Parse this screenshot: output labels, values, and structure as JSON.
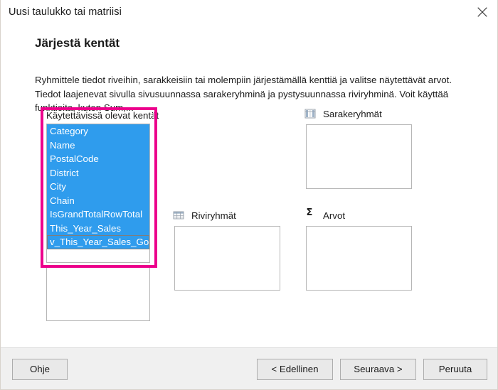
{
  "window": {
    "title": "Uusi taulukko tai matriisi",
    "close_icon": "close-icon"
  },
  "heading": "Järjestä kentät",
  "description": "Ryhmittele tiedot riveihin, sarakkeisiin tai molempiin järjestämällä kenttiä ja valitse näytettävät arvot. Tiedot laajenevat sivulla sivusuunnassa sarakeryhminä ja pystysuunnassa riviryhminä.  Voit käyttää funktioita, kuten Sum,...",
  "available_fields": {
    "label": "Käytettävissä olevat kentät",
    "items": [
      "Category",
      "Name",
      "PostalCode",
      "District",
      "City",
      "Chain",
      "IsGrandTotalRowTotal",
      "This_Year_Sales",
      "v_This_Year_Sales_Goal"
    ],
    "selection_color": "#2f9ced",
    "selection_text_color": "#ffffff",
    "focused_index": 8
  },
  "highlight": {
    "color": "#ec008c"
  },
  "column_groups": {
    "label": "Sarakeryhmät",
    "icon": "column-grid-icon",
    "items": []
  },
  "row_groups": {
    "label": "Riviryhmät",
    "icon": "row-grid-icon",
    "items": []
  },
  "values": {
    "label": "Arvot",
    "icon": "sigma-icon",
    "glyph": "Σ",
    "items": []
  },
  "footer": {
    "help_label": "Ohje",
    "previous_label": "< Edellinen",
    "next_label": "Seuraava >",
    "cancel_label": "Peruuta"
  }
}
